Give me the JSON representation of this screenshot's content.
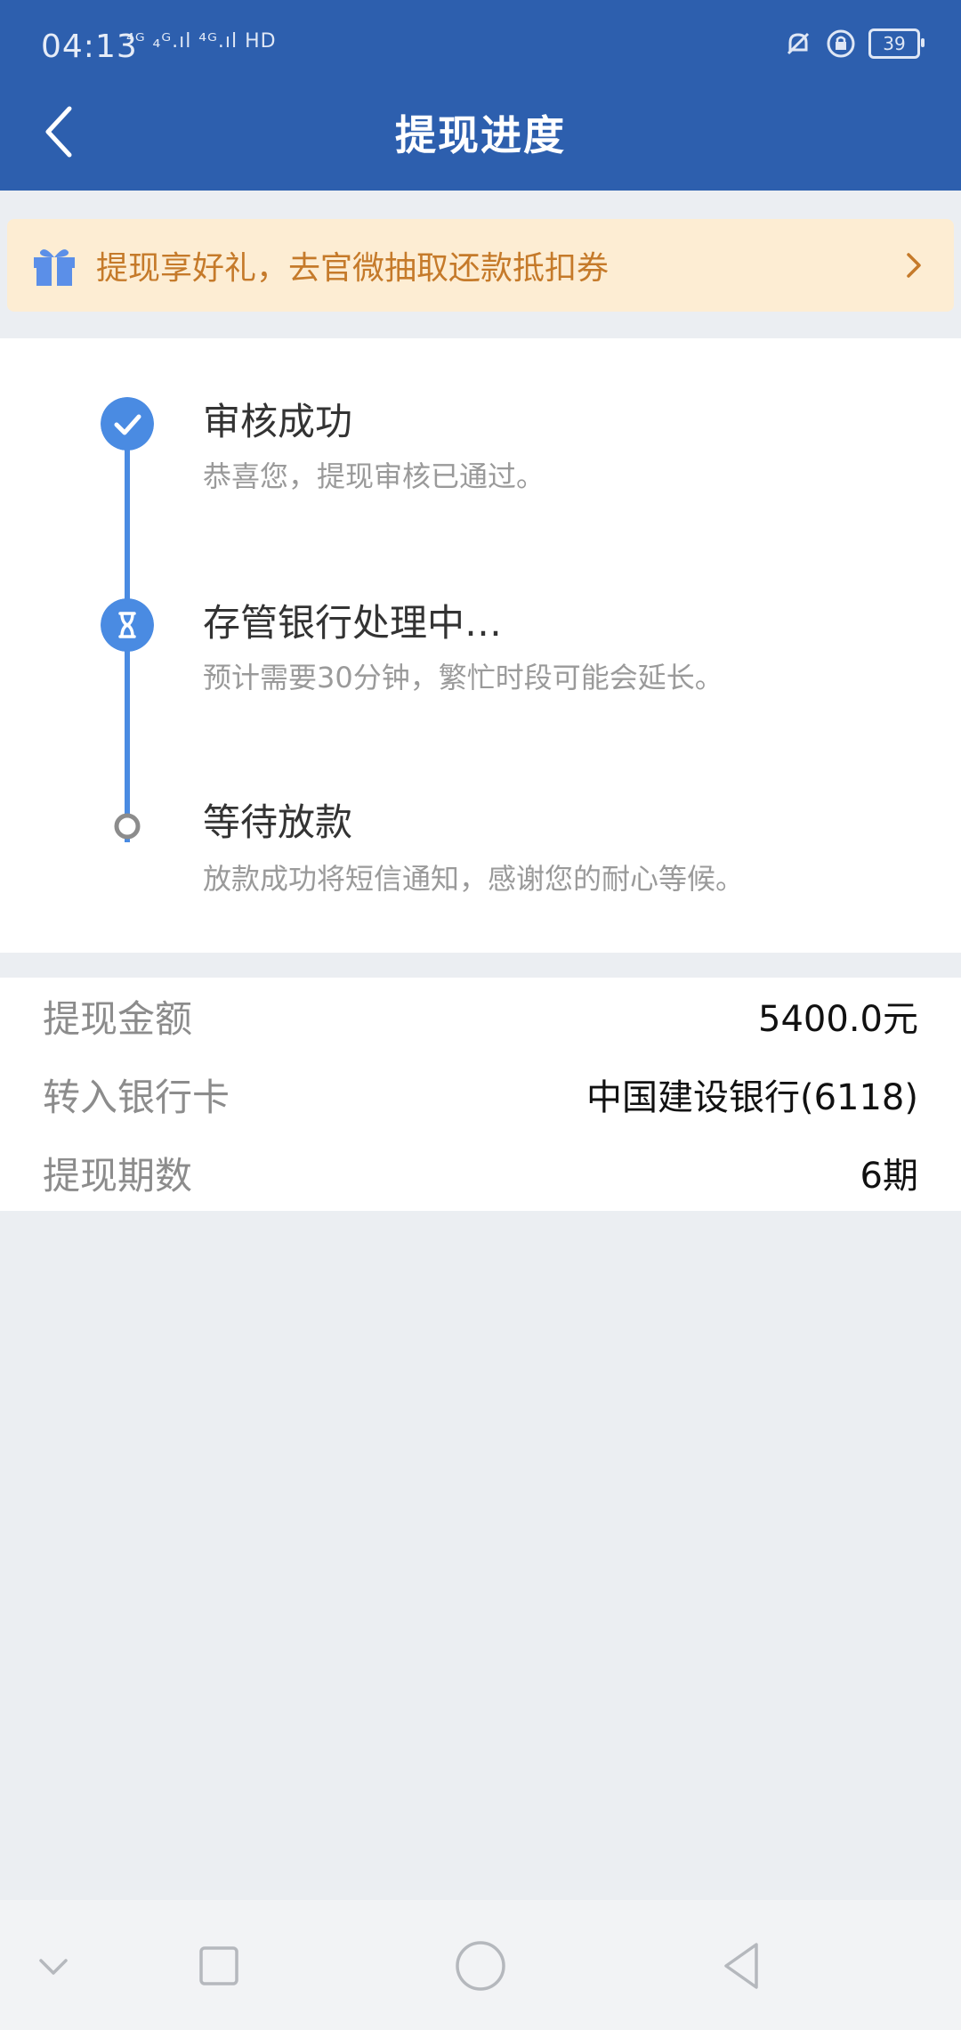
{
  "status_bar": {
    "time": "04:13",
    "signals": "⁴ᴳ ₄ᴳ.ıl ⁴ᴳ.ıl HD",
    "battery": "39"
  },
  "header": {
    "title": "提现进度"
  },
  "banner": {
    "text": "提现享好礼，去官微抽取还款抵扣券"
  },
  "steps": [
    {
      "title": "审核成功",
      "desc": "恭喜您，提现审核已通过。",
      "status": "done"
    },
    {
      "title": "存管银行处理中…",
      "desc": "预计需要30分钟，繁忙时段可能会延长。",
      "status": "processing"
    },
    {
      "title": "等待放款",
      "desc": "放款成功将短信通知，感谢您的耐心等候。",
      "status": "pending"
    }
  ],
  "info": {
    "amount_label": "提现金额",
    "amount_value": "5400.0元",
    "card_label": "转入银行卡",
    "card_value": "中国建设银行(6118)",
    "periods_label": "提现期数",
    "periods_value": "6期"
  },
  "colors": {
    "header_bg": "#2d5fae",
    "accent": "#4a8be2",
    "banner_bg": "#fdedd3",
    "banner_text": "#c57a2a"
  },
  "icons": [
    "back-arrow-icon",
    "gift-icon",
    "chevron-right-icon",
    "check-icon",
    "hourglass-icon",
    "pending-circle-icon",
    "mute-bell-icon",
    "lock-rotation-icon",
    "battery-icon",
    "nav-down-icon",
    "nav-recent-icon",
    "nav-home-icon",
    "nav-back-icon"
  ]
}
